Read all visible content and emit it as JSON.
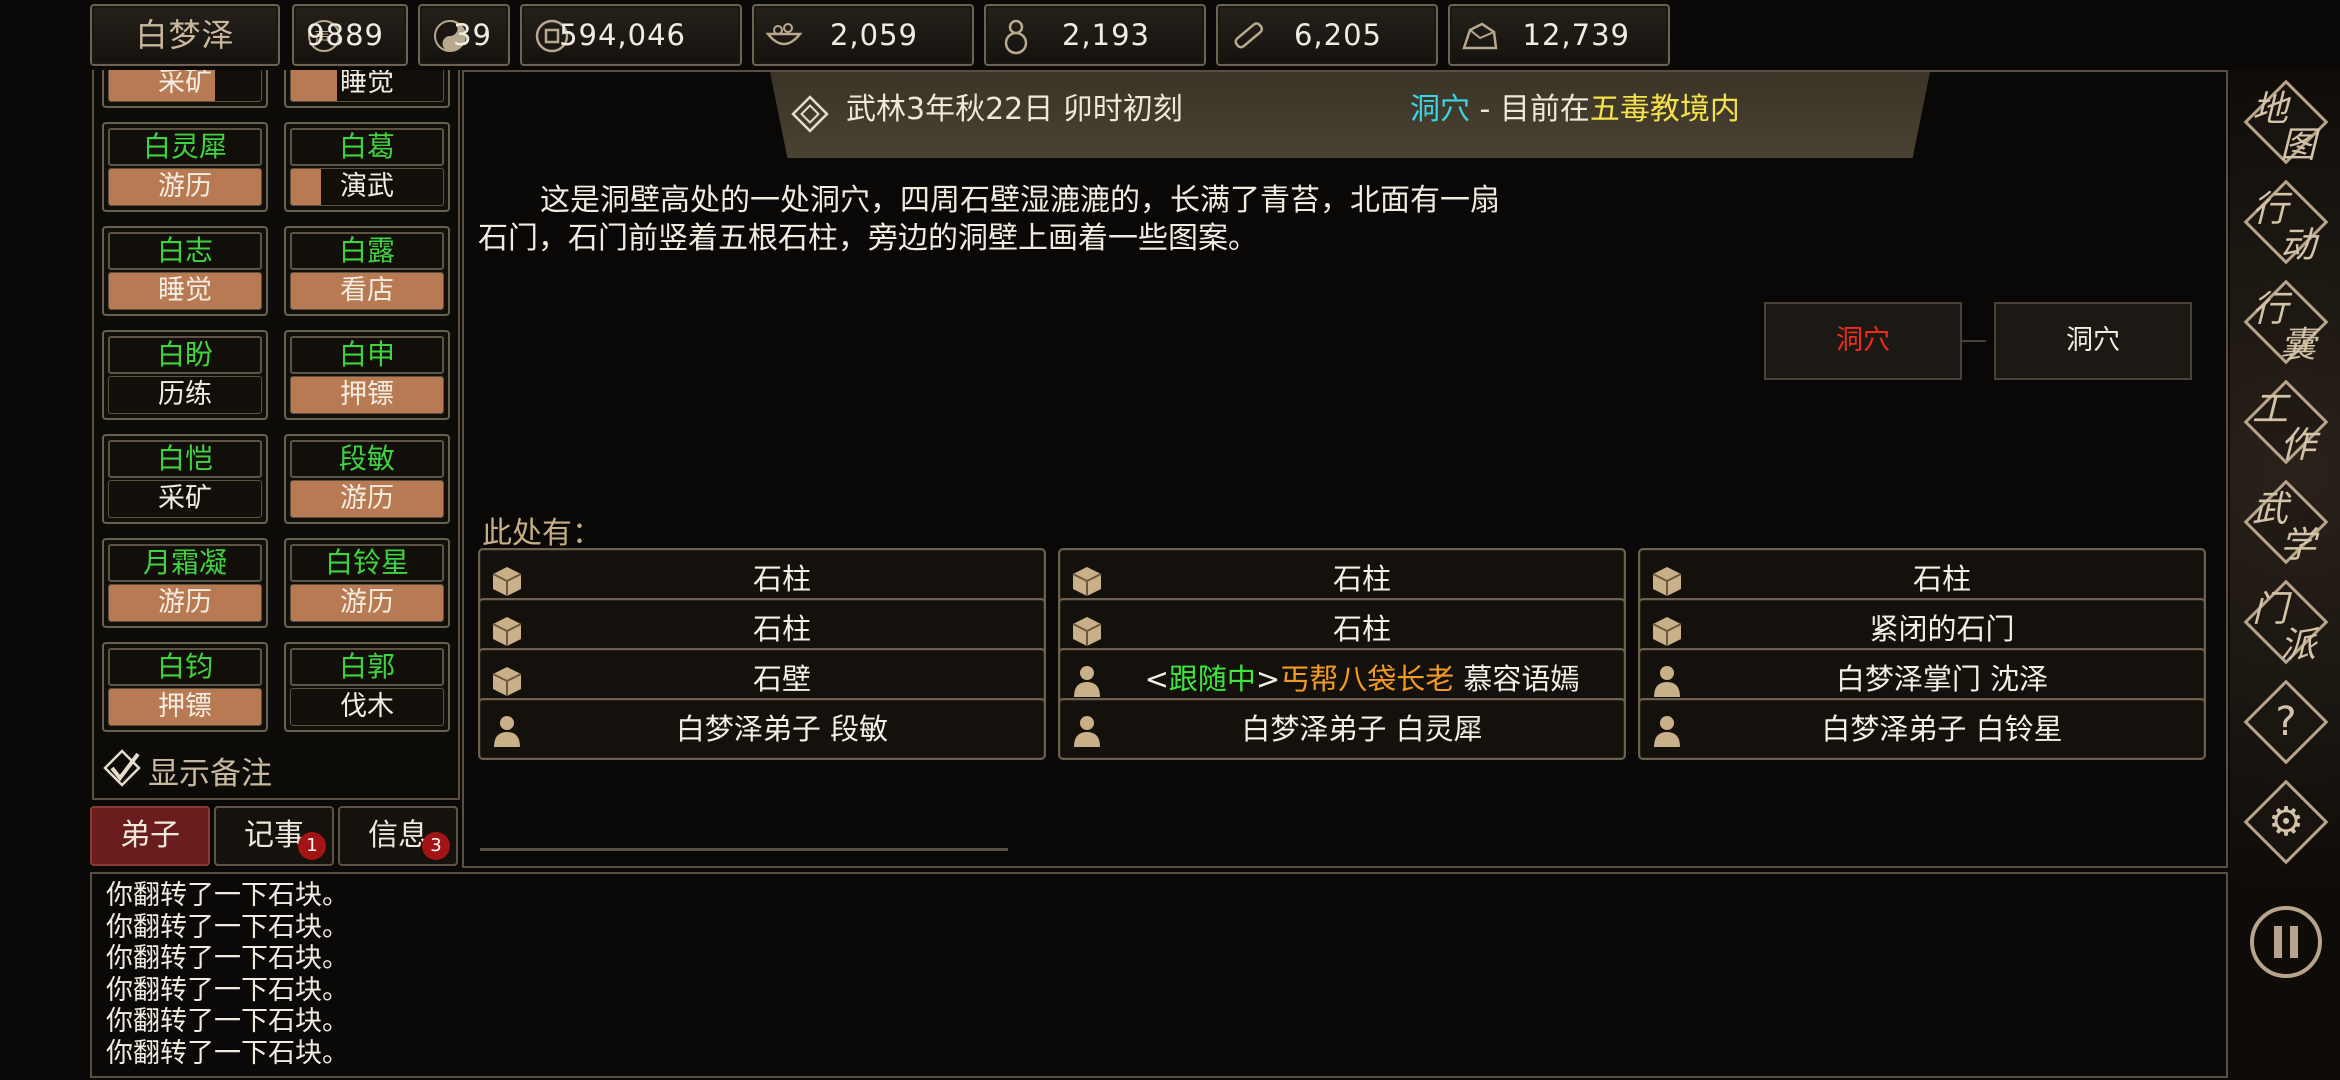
{
  "topbar": {
    "player_name": "白梦泽",
    "stats": [
      {
        "icon": "prestige-icon",
        "value": "9889"
      },
      {
        "icon": "yinyang-icon",
        "value": "39"
      },
      {
        "icon": "coin-icon",
        "value": "594,046"
      },
      {
        "icon": "food-bowl-icon",
        "value": "2,059"
      },
      {
        "icon": "gourd-icon",
        "value": "2,193"
      },
      {
        "icon": "wood-icon",
        "value": "6,205"
      },
      {
        "icon": "ore-icon",
        "value": "12,739"
      }
    ]
  },
  "sidebar": {
    "top_partial": [
      {
        "action": "采矿",
        "progress": 0.7
      },
      {
        "action": "睡觉",
        "progress": 0.3
      }
    ],
    "disciples": [
      {
        "name": "白灵犀",
        "action": "游历",
        "progress": 1.0
      },
      {
        "name": "白葛",
        "action": "演武",
        "progress": 0.2
      },
      {
        "name": "白志",
        "action": "睡觉",
        "progress": 1.0
      },
      {
        "name": "白露",
        "action": "看店",
        "progress": 1.0
      },
      {
        "name": "白盼",
        "action": "历练",
        "progress": 0.0
      },
      {
        "name": "白申",
        "action": "押镖",
        "progress": 1.0
      },
      {
        "name": "白恺",
        "action": "采矿",
        "progress": 0.0
      },
      {
        "name": "段敏",
        "action": "游历",
        "progress": 1.0
      },
      {
        "name": "月霜凝",
        "action": "游历",
        "progress": 1.0
      },
      {
        "name": "白铃星",
        "action": "游历",
        "progress": 1.0
      },
      {
        "name": "白钧",
        "action": "押镖",
        "progress": 1.0
      },
      {
        "name": "白郭",
        "action": "伐木",
        "progress": 0.0
      }
    ],
    "show_notes_label": "显示备注"
  },
  "tabs": [
    {
      "label": "弟子",
      "badge": ""
    },
    {
      "label": "记事",
      "badge": "1"
    },
    {
      "label": "信息",
      "badge": "3"
    }
  ],
  "header": {
    "time": "武林3年秋22日 卯时初刻",
    "place": "洞穴",
    "separator": " - ",
    "current_prefix": "目前在",
    "region": "五毒教境内"
  },
  "description": "这是洞壁高处的一处洞穴，四周石壁湿漉漉的，长满了青苔，北面有一扇石门，石门前竖着五根石柱，旁边的洞壁上画着一些图案。",
  "map": {
    "current_node": "洞穴",
    "adjacent_node": "洞穴"
  },
  "here": {
    "label": "此处有：",
    "entities": [
      {
        "type": "object",
        "label": "石柱"
      },
      {
        "type": "object",
        "label": "石柱"
      },
      {
        "type": "object",
        "label": "石柱"
      },
      {
        "type": "object",
        "label": "石柱"
      },
      {
        "type": "object",
        "label": "石柱"
      },
      {
        "type": "object",
        "label": "紧闭的石门"
      },
      {
        "type": "object",
        "label": "石壁"
      },
      {
        "type": "person",
        "follow_open": "<",
        "follow": "跟随中",
        "follow_close": ">",
        "title": "丐帮八袋长老",
        "name": " 慕容语嫣"
      },
      {
        "type": "person",
        "label": "白梦泽掌门 沈泽"
      },
      {
        "type": "person",
        "label": "白梦泽弟子 段敏"
      },
      {
        "type": "person",
        "label": "白梦泽弟子 白灵犀"
      },
      {
        "type": "person",
        "label": "白梦泽弟子 白铃星"
      }
    ]
  },
  "log": [
    "你翻转了一下石块。",
    "你翻转了一下石块。",
    "你翻转了一下石块。",
    "你翻转了一下石块。",
    "你翻转了一下石块。",
    "你翻转了一下石块。"
  ],
  "right_menu": [
    {
      "a": "地",
      "b": "图"
    },
    {
      "a": "行",
      "b": "动"
    },
    {
      "a": "行",
      "b": "囊"
    },
    {
      "a": "工",
      "b": "作"
    },
    {
      "a": "武",
      "b": "学"
    },
    {
      "a": "门",
      "b": "派"
    }
  ],
  "colors": {
    "green_name": "#3fd43f",
    "progress_fill": "#b87a52",
    "place_cyan": "#3bd6e6",
    "region_yellow": "#f4e24a",
    "current_node_red": "#f02a1c",
    "title_orange": "#f39a23"
  }
}
